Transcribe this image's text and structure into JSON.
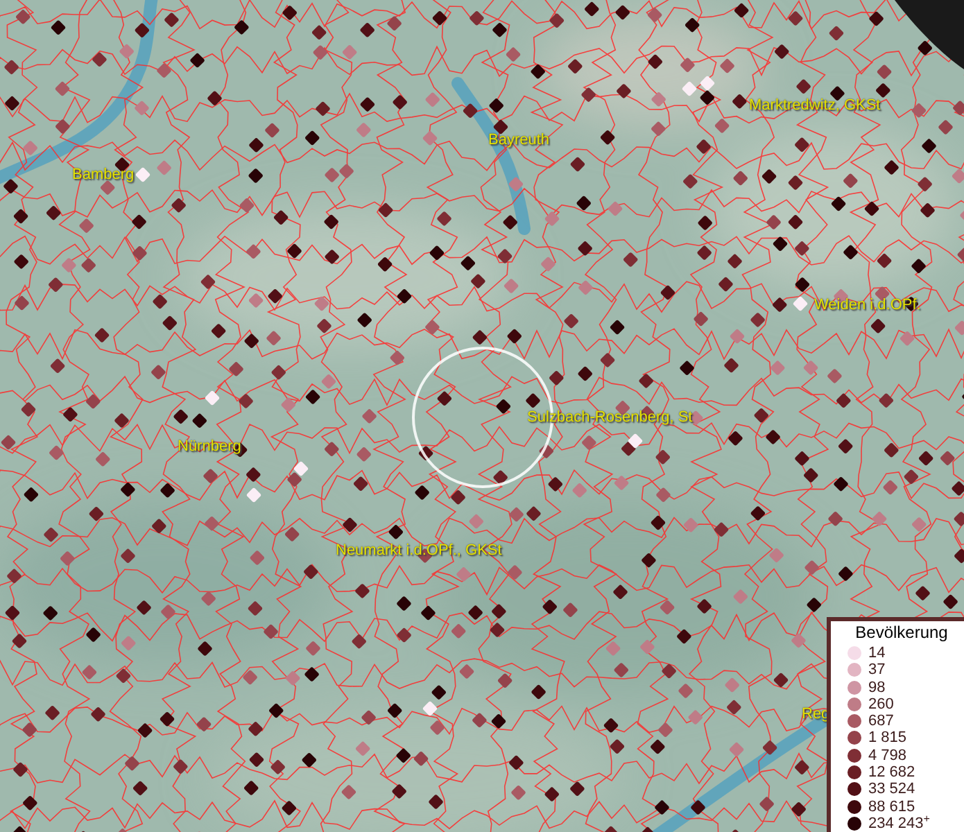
{
  "map": {
    "places": [
      {
        "label": "Bamberg"
      },
      {
        "label": "Bayreuth"
      },
      {
        "label": "Marktredwitz, GKSt"
      },
      {
        "label": "Weiden i.d.OPf."
      },
      {
        "label": "Nürnberg"
      },
      {
        "label": "Sulzbach-Rosenberg, St"
      },
      {
        "label": "Neumarkt i.d.OPf., GKSt"
      },
      {
        "label": "Reg"
      }
    ]
  },
  "legend": {
    "title": "Bevölkerung",
    "items": [
      {
        "label": "14",
        "color": "#f5dce8"
      },
      {
        "label": "37",
        "color": "#e2b5c2"
      },
      {
        "label": "98",
        "color": "#cf95a3"
      },
      {
        "label": "260",
        "color": "#bf7c87"
      },
      {
        "label": "687",
        "color": "#a95a63"
      },
      {
        "label": "1 815",
        "color": "#94434b"
      },
      {
        "label": "4 798",
        "color": "#7f2e35"
      },
      {
        "label": "12 682",
        "color": "#6a1e24"
      },
      {
        "label": "33 524",
        "color": "#521016"
      },
      {
        "label": "88 615",
        "color": "#3e080c"
      },
      {
        "label": "234 243$^{+}$",
        "color": "#280306"
      }
    ]
  }
}
